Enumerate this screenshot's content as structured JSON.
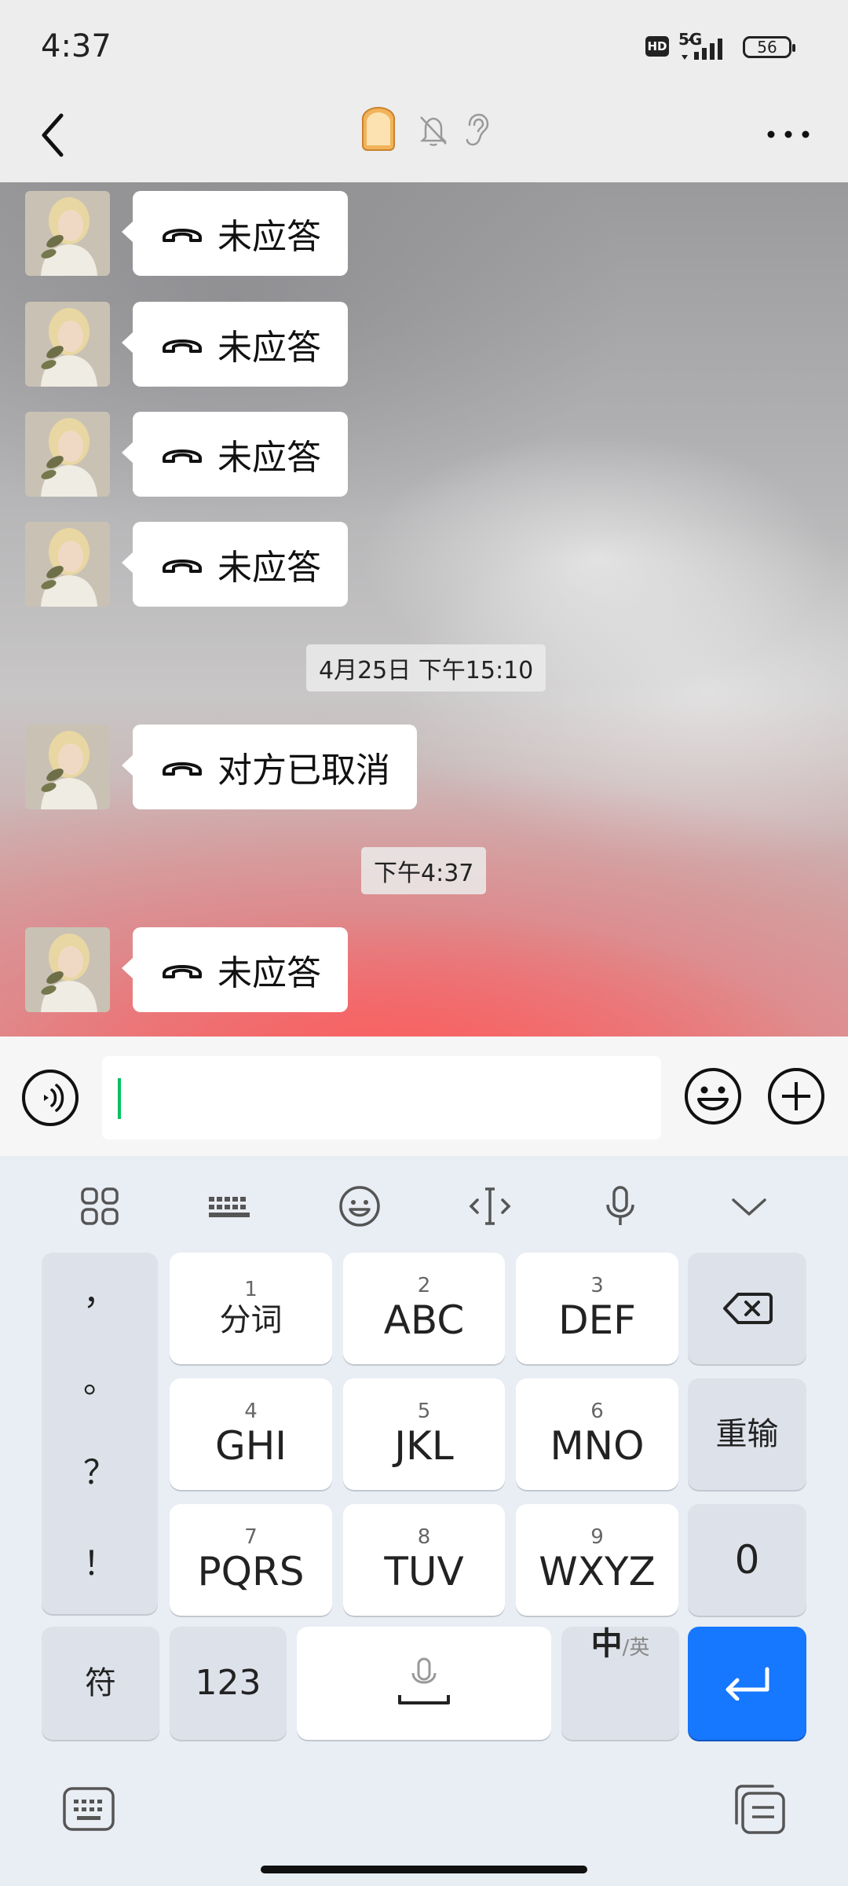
{
  "status_bar": {
    "time": "4:37",
    "hd": "HD",
    "network": "5G",
    "battery": "56"
  },
  "header": {
    "back": "back",
    "contact_avatar_icon": "bread-icon",
    "mute_icon": "muted-bell-icon",
    "earpiece_icon": "ear-icon",
    "more": "more-icon"
  },
  "chat": {
    "messages": [
      {
        "type": "call",
        "text": "未应答"
      },
      {
        "type": "call",
        "text": "未应答"
      },
      {
        "type": "call",
        "text": "未应答"
      },
      {
        "type": "call",
        "text": "未应答"
      },
      {
        "type": "timestamp",
        "text": "4月25日 下午15:10"
      },
      {
        "type": "call",
        "text": "对方已取消"
      },
      {
        "type": "timestamp",
        "text": "下午4:37"
      },
      {
        "type": "call",
        "text": "未应答"
      }
    ]
  },
  "input_bar": {
    "value": "",
    "voice_icon": "voice-icon",
    "emoji_icon": "emoji-icon",
    "plus_icon": "plus-icon"
  },
  "keyboard": {
    "toolbar": [
      "apps-grid-icon",
      "keyboard-icon",
      "emoji-icon",
      "cursor-move-icon",
      "microphone-icon",
      "collapse-icon"
    ],
    "punctuation": [
      "，",
      "。",
      "？",
      "！"
    ],
    "keys": [
      {
        "num": "1",
        "label": "分词"
      },
      {
        "num": "2",
        "label": "ABC"
      },
      {
        "num": "3",
        "label": "DEF"
      },
      {
        "num": "4",
        "label": "GHI"
      },
      {
        "num": "5",
        "label": "JKL"
      },
      {
        "num": "6",
        "label": "MNO"
      },
      {
        "num": "7",
        "label": "PQRS"
      },
      {
        "num": "8",
        "label": "TUV"
      },
      {
        "num": "9",
        "label": "WXYZ"
      }
    ],
    "delete_icon": "backspace-icon",
    "reenter": "重输",
    "zero": "0",
    "symbols": "符",
    "numbers": "123",
    "space_icon": "space-mic-icon",
    "lang_main": "中",
    "lang_alt": "/英",
    "enter_icon": "enter-icon"
  },
  "bottom_nav": {
    "left_icon": "keyboard-switch-icon",
    "right_icon": "clipboard-icon"
  }
}
